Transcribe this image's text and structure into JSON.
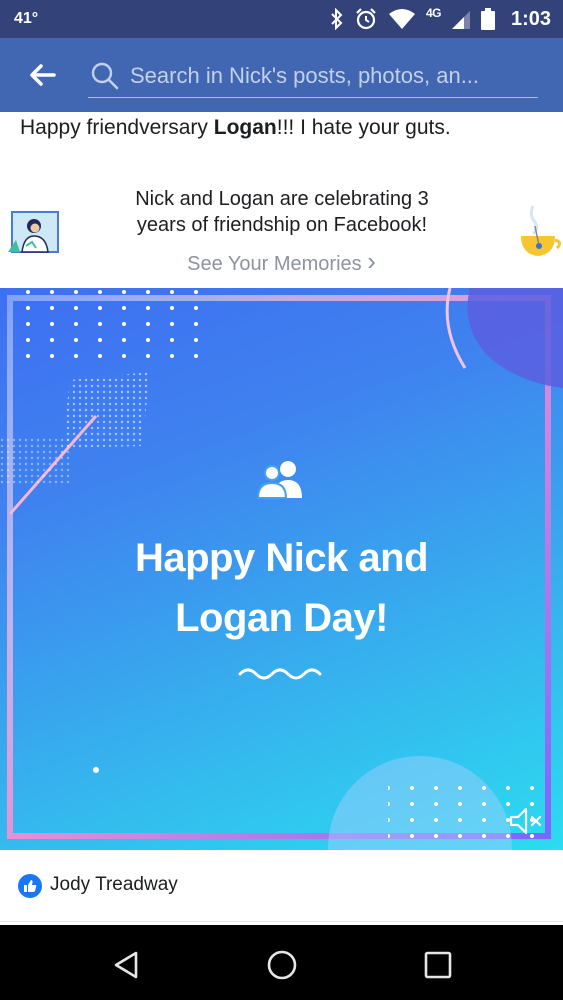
{
  "status_bar": {
    "temperature": "41°",
    "network": "4G",
    "time": "1:03"
  },
  "header": {
    "search_placeholder": "Search in Nick's posts, photos, an...",
    "back_icon": "arrow-left-icon",
    "search_icon": "search-icon"
  },
  "post": {
    "text_before": "Happy friendversary ",
    "text_bold": "Logan",
    "text_after": "!!! I hate your guts."
  },
  "memories": {
    "line1": "Nick and Logan are celebrating 3",
    "line2": "years of friendship on Facebook!",
    "link_label": "See Your Memories",
    "link_chevron": "›"
  },
  "card": {
    "line1": "Happy Nick and",
    "line2": "Logan Day!",
    "icon": "friends-icon",
    "mute_icon": "volume-mute-icon"
  },
  "reactions": {
    "reactor_name": "Jody Treadway",
    "icon": "like-icon"
  },
  "colors": {
    "header": "#4267b2",
    "status_bar": "#33437a",
    "like": "#1877f2",
    "muted_text": "#8d949e"
  }
}
